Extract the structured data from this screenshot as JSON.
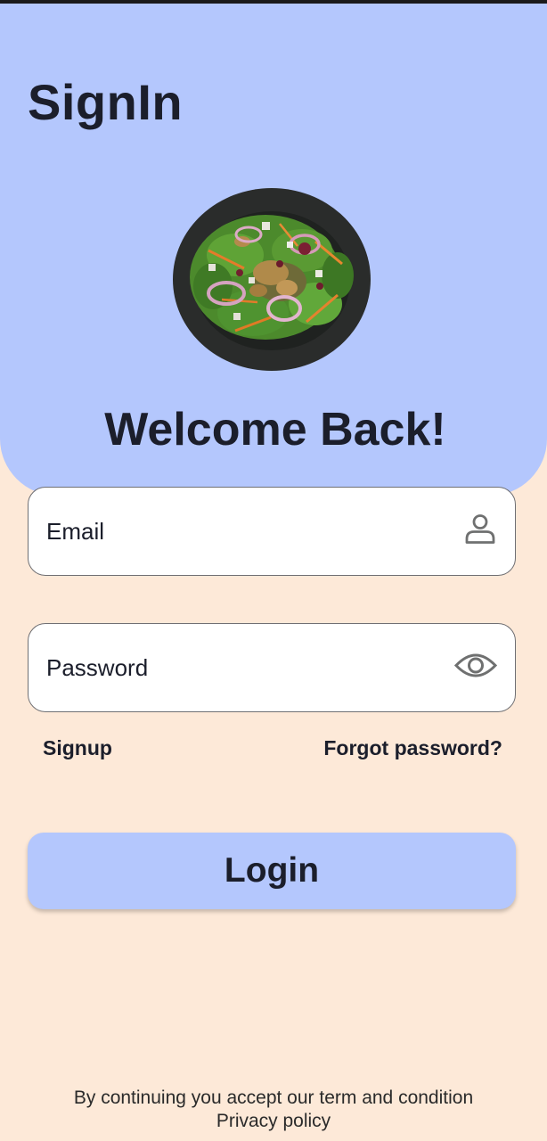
{
  "header": {
    "title": "SignIn",
    "welcome": "Welcome Back!",
    "hero_image": "salad-bowl-photo"
  },
  "form": {
    "email": {
      "placeholder": "Email",
      "value": "",
      "icon": "person-icon"
    },
    "password": {
      "placeholder": "Password",
      "value": "",
      "icon": "eye-icon"
    }
  },
  "links": {
    "signup": "Signup",
    "forgot_password": "Forgot password?"
  },
  "actions": {
    "login": "Login"
  },
  "footer": {
    "terms": "By continuing you accept our term and condition",
    "privacy": "Privacy policy"
  },
  "colors": {
    "header_background": "#b4c7fd",
    "page_background": "#fde9d8",
    "button_background": "#b4c7fd",
    "text": "#1b1e2b"
  }
}
